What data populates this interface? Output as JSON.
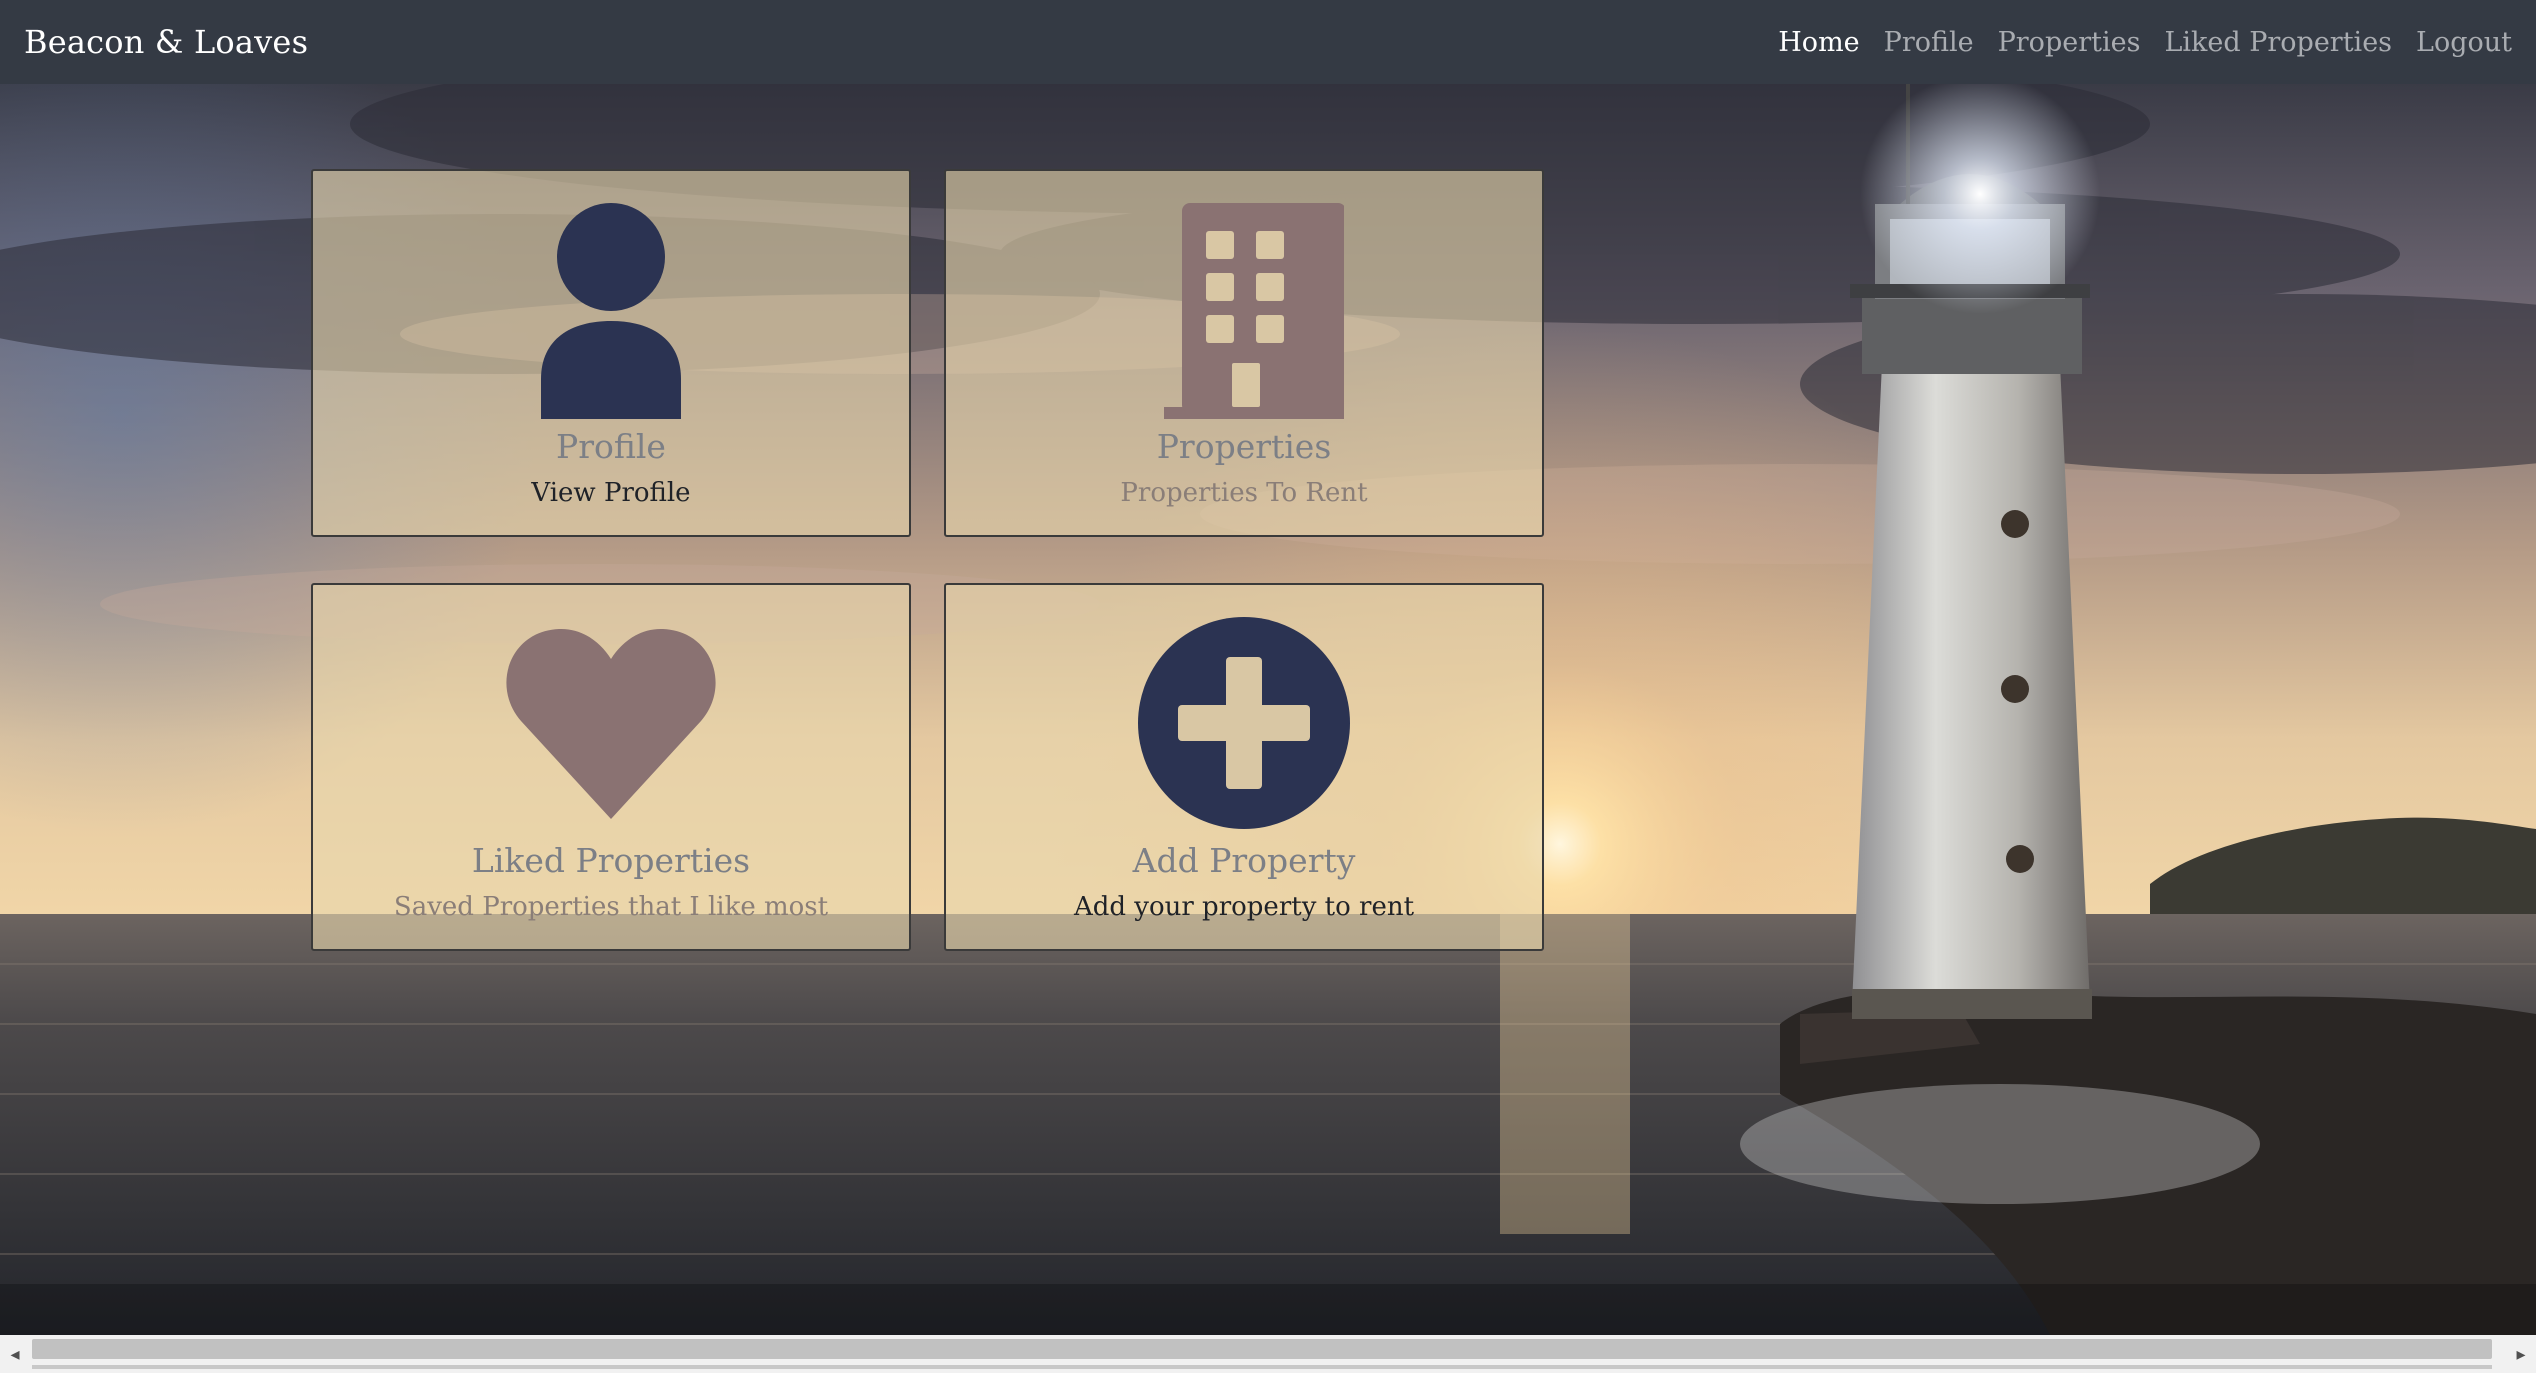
{
  "navbar": {
    "brand": "Beacon & Loaves",
    "links": [
      {
        "label": "Home",
        "active": true
      },
      {
        "label": "Profile",
        "active": false
      },
      {
        "label": "Properties",
        "active": false
      },
      {
        "label": "Liked Properties",
        "active": false
      },
      {
        "label": "Logout",
        "active": false
      }
    ]
  },
  "cards": [
    {
      "title": "Profile",
      "subtitle": "View Profile",
      "icon": "user-icon",
      "icon_color": "#2b3352"
    },
    {
      "title": "Properties",
      "subtitle": "Properties To Rent",
      "icon": "building-icon",
      "icon_color": "#8a7272"
    },
    {
      "title": "Liked Properties",
      "subtitle": "Saved Properties that I like most",
      "icon": "heart-icon",
      "icon_color": "#8a7272"
    },
    {
      "title": "Add Property",
      "subtitle": "Add your property to rent",
      "icon": "plus-circle-icon",
      "icon_color": "#2b3352"
    }
  ],
  "colors": {
    "navbar_bg": "#343a44",
    "nav_active": "#ffffff",
    "nav_inactive": "#a9acb1",
    "card_bg": "rgba(232,214,172,0.62)",
    "icon_navy": "#2b3352",
    "icon_mauve": "#8a7272"
  },
  "background": {
    "icon": "lighthouse-sunset-image"
  },
  "scrollbar": {
    "left_arrow": "◂",
    "right_arrow": "▸"
  }
}
